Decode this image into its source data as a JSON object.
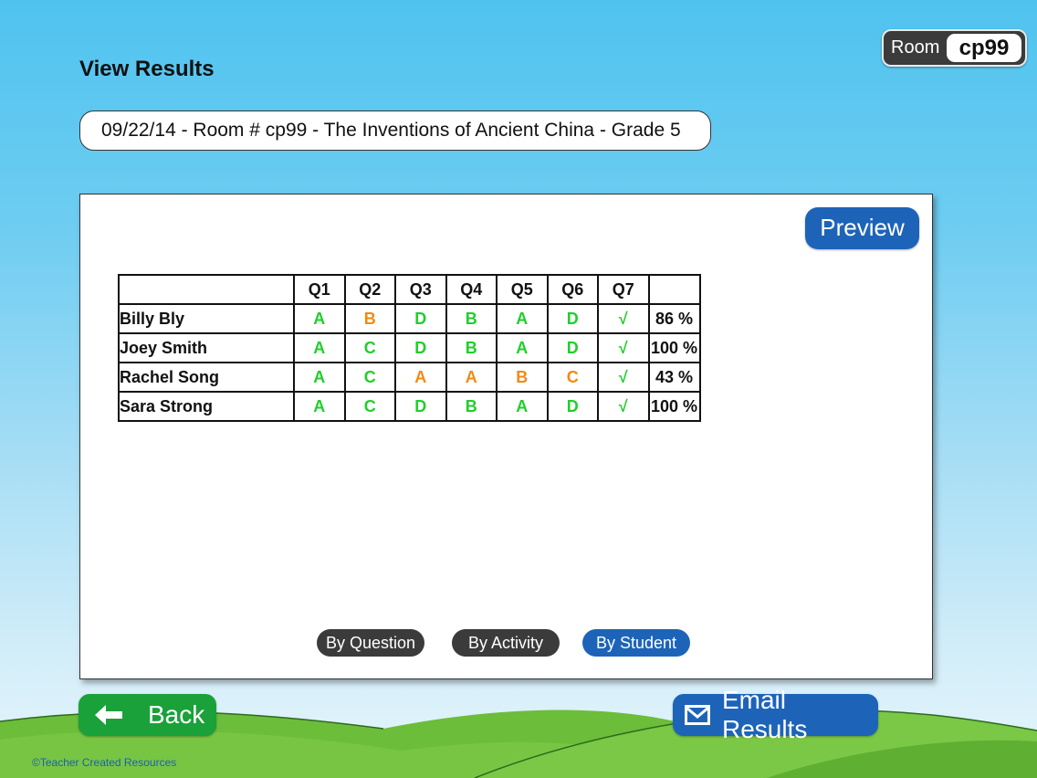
{
  "header": {
    "title": "View Results",
    "room_label": "Room",
    "room_code": "cp99"
  },
  "session": {
    "label": "09/22/14 - Room # cp99 - The Inventions of Ancient China - Grade 5"
  },
  "panel": {
    "preview_label": "Preview",
    "table": {
      "columns": [
        "Q1",
        "Q2",
        "Q3",
        "Q4",
        "Q5",
        "Q6",
        "Q7"
      ],
      "rows": [
        {
          "name": "Billy Bly",
          "answers": [
            {
              "value": "A",
              "status": "correct"
            },
            {
              "value": "B",
              "status": "wrong"
            },
            {
              "value": "D",
              "status": "correct"
            },
            {
              "value": "B",
              "status": "correct"
            },
            {
              "value": "A",
              "status": "correct"
            },
            {
              "value": "D",
              "status": "correct"
            },
            {
              "value": "√",
              "status": "correct"
            }
          ],
          "score": "86 %"
        },
        {
          "name": "Joey Smith",
          "answers": [
            {
              "value": "A",
              "status": "correct"
            },
            {
              "value": "C",
              "status": "correct"
            },
            {
              "value": "D",
              "status": "correct"
            },
            {
              "value": "B",
              "status": "correct"
            },
            {
              "value": "A",
              "status": "correct"
            },
            {
              "value": "D",
              "status": "correct"
            },
            {
              "value": "√",
              "status": "correct"
            }
          ],
          "score": "100 %"
        },
        {
          "name": "Rachel Song",
          "answers": [
            {
              "value": "A",
              "status": "correct"
            },
            {
              "value": "C",
              "status": "correct"
            },
            {
              "value": "A",
              "status": "wrong"
            },
            {
              "value": "A",
              "status": "wrong"
            },
            {
              "value": "B",
              "status": "wrong"
            },
            {
              "value": "C",
              "status": "wrong"
            },
            {
              "value": "√",
              "status": "correct"
            }
          ],
          "score": "43 %"
        },
        {
          "name": "Sara Strong",
          "answers": [
            {
              "value": "A",
              "status": "correct"
            },
            {
              "value": "C",
              "status": "correct"
            },
            {
              "value": "D",
              "status": "correct"
            },
            {
              "value": "B",
              "status": "correct"
            },
            {
              "value": "A",
              "status": "correct"
            },
            {
              "value": "D",
              "status": "correct"
            },
            {
              "value": "√",
              "status": "correct"
            }
          ],
          "score": "100 %"
        }
      ]
    },
    "view_tabs": [
      {
        "label": "By Question",
        "active": false
      },
      {
        "label": "By Activity",
        "active": false
      },
      {
        "label": "By Student",
        "active": true
      }
    ]
  },
  "footer": {
    "back_label": "Back",
    "back_icon": "arrow-left-icon",
    "email_label": "Email Results",
    "email_icon": "envelope-icon",
    "copyright": "©Teacher Created Resources"
  },
  "colors": {
    "correct": "#1fcf2a",
    "wrong": "#f28a12",
    "accent_blue": "#1d64b9",
    "back_green": "#1aa13a",
    "dark_pill": "#3b3b3b"
  }
}
